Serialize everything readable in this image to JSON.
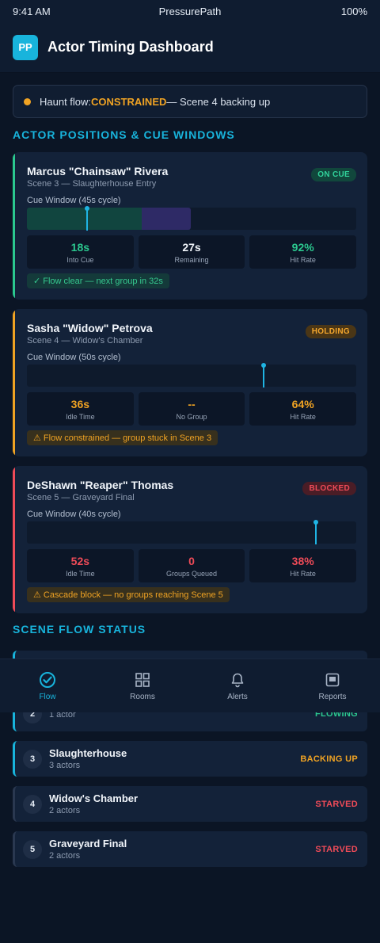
{
  "status_bar": {
    "time": "9:41 AM",
    "carrier": "PressurePath",
    "battery": "100%"
  },
  "header": {
    "logo_text": "PP",
    "title": "Actor Timing Dashboard"
  },
  "banner": {
    "prefix": "Haunt flow: ",
    "state": "CONSTRAINED",
    "suffix": " — Scene 4 backing up"
  },
  "sections": {
    "actors_title": "ACTOR POSITIONS & CUE WINDOWS",
    "scenes_title": "SCENE FLOW STATUS"
  },
  "colors": {
    "accent": "#18b4dc",
    "green": "#2bc88f",
    "amber": "#f0a323",
    "red": "#ef4b58"
  },
  "actors": [
    {
      "name": "Marcus \"Chainsaw\" Rivera",
      "scene": "Scene 3 — Slaughterhouse Entry",
      "badge": "ON CUE",
      "status": "on-cue",
      "cue_label": "Cue Window (45s cycle)",
      "cue_progress": 0.18,
      "window_active": 0.35,
      "window_queued": 0.15,
      "stats": [
        {
          "value": "18s",
          "label": "Into Cue",
          "tone": "green"
        },
        {
          "value": "27s",
          "label": "Remaining",
          "tone": "white"
        },
        {
          "value": "92%",
          "label": "Hit Rate",
          "tone": "green"
        }
      ],
      "note": "✓ Flow clear — next group in 32s",
      "note_tone": "green"
    },
    {
      "name": "Sasha \"Widow\" Petrova",
      "scene": "Scene 4 — Widow's Chamber",
      "badge": "HOLDING",
      "status": "holding",
      "cue_label": "Cue Window (50s cycle)",
      "cue_progress": 0.72,
      "window_active": 0,
      "window_queued": 0,
      "stats": [
        {
          "value": "36s",
          "label": "Idle Time",
          "tone": "amber"
        },
        {
          "value": "--",
          "label": "No Group",
          "tone": "amber"
        },
        {
          "value": "64%",
          "label": "Hit Rate",
          "tone": "amber"
        }
      ],
      "note": "⚠ Flow constrained — group stuck in Scene 3",
      "note_tone": "amber"
    },
    {
      "name": "DeShawn \"Reaper\" Thomas",
      "scene": "Scene 5 — Graveyard Final",
      "badge": "BLOCKED",
      "status": "blocked",
      "cue_label": "Cue Window (40s cycle)",
      "cue_progress": 0.88,
      "window_active": 0,
      "window_queued": 0,
      "stats": [
        {
          "value": "52s",
          "label": "Idle Time",
          "tone": "red"
        },
        {
          "value": "0",
          "label": "Groups Queued",
          "tone": "red"
        },
        {
          "value": "38%",
          "label": "Hit Rate",
          "tone": "red"
        }
      ],
      "note": "⚠ Cascade block — no groups reaching Scene 5",
      "note_tone": "amber"
    }
  ],
  "scenes": [
    {
      "num": "2",
      "name": "",
      "sub": "1 actor",
      "status": "FLOWING",
      "tone": "green",
      "border": "accent"
    },
    {
      "num": "3",
      "name": "Slaughterhouse",
      "sub": "3 actors",
      "status": "BACKING UP",
      "tone": "amber",
      "border": "accent"
    },
    {
      "num": "4",
      "name": "Widow's Chamber",
      "sub": "2 actors",
      "status": "STARVED",
      "tone": "red",
      "border": "dim"
    },
    {
      "num": "5",
      "name": "Graveyard Final",
      "sub": "2 actors",
      "status": "STARVED",
      "tone": "red",
      "border": "dim"
    }
  ],
  "nav": [
    {
      "label": "Flow",
      "icon": "check-circle-icon",
      "active": true
    },
    {
      "label": "Rooms",
      "icon": "grid-icon",
      "active": false
    },
    {
      "label": "Alerts",
      "icon": "bell-icon",
      "active": false
    },
    {
      "label": "Reports",
      "icon": "report-icon",
      "active": false
    }
  ]
}
